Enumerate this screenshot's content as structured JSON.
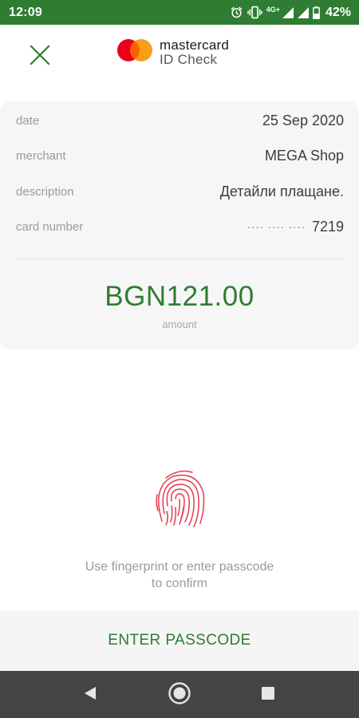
{
  "status_bar": {
    "time": "12:09",
    "network": "4G+",
    "battery_percent": "42%",
    "icons": [
      "alarm-icon",
      "vibrate-icon",
      "signal-icon",
      "signal-icon",
      "battery-icon"
    ],
    "background_color": "#2e7d32"
  },
  "header": {
    "brand_name": "mastercard",
    "brand_sub": "ID Check",
    "close_icon": "close-icon"
  },
  "transaction": {
    "rows": [
      {
        "label": "date",
        "value": "25 Sep 2020"
      },
      {
        "label": "merchant",
        "value": "MEGA Shop"
      },
      {
        "label": "description",
        "value": "Детайли плащане."
      }
    ],
    "card_number_label": "card number",
    "card_number_mask": "···· ···· ····",
    "card_number_last4": "7219",
    "amount": "BGN121.00",
    "amount_label": "amount"
  },
  "auth": {
    "fingerprint_icon": "fingerprint-icon",
    "hint_line1": "Use fingerprint or enter passcode",
    "hint_line2": "to confirm",
    "passcode_button": "ENTER PASSCODE"
  },
  "nav_bar": {
    "buttons": [
      "back-icon",
      "home-icon",
      "recents-icon"
    ]
  },
  "colors": {
    "accent": "#2e7d32",
    "fingerprint": "#e53950",
    "mastercard_red": "#eb001b",
    "mastercard_orange": "#f79e1b"
  }
}
